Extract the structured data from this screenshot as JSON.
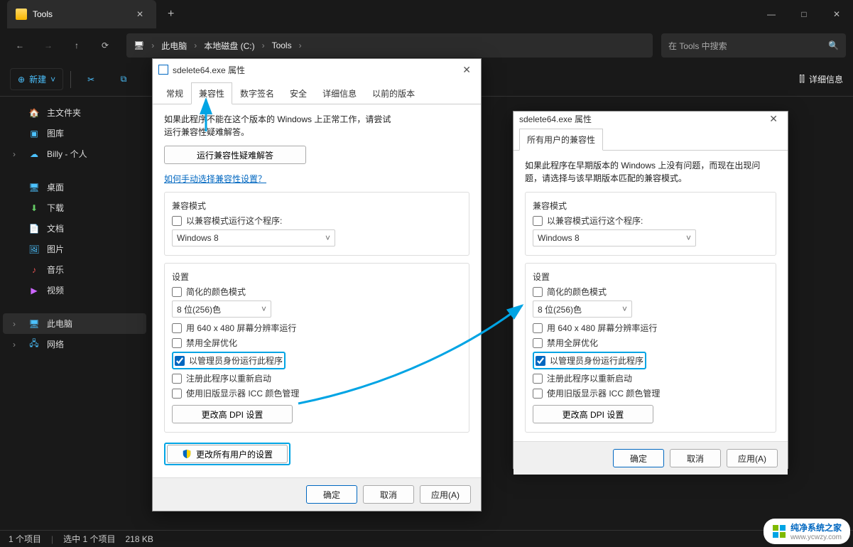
{
  "titlebar": {
    "tab_title": "Tools",
    "newtab": "+"
  },
  "nav": {
    "breadcrumbs": [
      "此电脑",
      "本地磁盘 (C:)",
      "Tools"
    ],
    "search_placeholder": "在 Tools 中搜索"
  },
  "toolbar": {
    "new_label": "新建",
    "details_label": "详细信息"
  },
  "sidebar": {
    "home": "主文件夹",
    "gallery": "图库",
    "user": "Billy - 个人",
    "desktop": "桌面",
    "downloads": "下载",
    "documents": "文档",
    "pictures": "图片",
    "music": "音乐",
    "videos": "视频",
    "thispc": "此电脑",
    "network": "网络"
  },
  "statusbar": {
    "items": "1 个项目",
    "selected": "选中 1 个项目",
    "size": "218 KB"
  },
  "dialog1": {
    "title": "sdelete64.exe 属性",
    "tabs": [
      "常规",
      "兼容性",
      "数字签名",
      "安全",
      "详细信息",
      "以前的版本"
    ],
    "active_tab": 1,
    "intro": "如果此程序不能在这个版本的 Windows 上正常工作，请尝试运行兼容性疑难解答。",
    "troubleshoot_btn": "运行兼容性疑难解答",
    "manual_link": "如何手动选择兼容性设置？",
    "compat_mode_label": "兼容模式",
    "compat_checkbox": "以兼容模式运行这个程序:",
    "compat_os": "Windows 8",
    "settings_label": "设置",
    "reduced_color": "简化的颜色模式",
    "color_depth": "8 位(256)色",
    "res_640": "用 640 x 480 屏幕分辨率运行",
    "disable_fullscreen": "禁用全屏优化",
    "run_admin": "以管理员身份运行此程序",
    "register_restart": "注册此程序以重新启动",
    "legacy_icc": "使用旧版显示器 ICC 颜色管理",
    "change_dpi": "更改高 DPI 设置",
    "all_users_btn": "更改所有用户的设置",
    "ok": "确定",
    "cancel": "取消",
    "apply": "应用(A)"
  },
  "dialog2": {
    "title": "sdelete64.exe 属性",
    "tab": "所有用户的兼容性",
    "intro": "如果此程序在早期版本的 Windows 上没有问题，而现在出现问题，请选择与该早期版本匹配的兼容模式。",
    "compat_mode_label": "兼容模式",
    "compat_checkbox": "以兼容模式运行这个程序:",
    "compat_os": "Windows 8",
    "settings_label": "设置",
    "reduced_color": "简化的颜色模式",
    "color_depth": "8 位(256)色",
    "res_640": "用 640 x 480 屏幕分辨率运行",
    "disable_fullscreen": "禁用全屏优化",
    "run_admin": "以管理员身份运行此程序",
    "register_restart": "注册此程序以重新启动",
    "legacy_icc": "使用旧版显示器 ICC 颜色管理",
    "change_dpi": "更改高 DPI 设置",
    "ok": "确定",
    "cancel": "取消",
    "apply": "应用(A)"
  },
  "watermark": {
    "brand": "纯净系统之家",
    "url": "www.ycwzy.com"
  },
  "icons": {
    "minimize": "—",
    "maximize": "□",
    "close": "✕",
    "back": "←",
    "forward": "→",
    "up": "↑",
    "refresh": "⟳",
    "monitor": "🖥",
    "chevron": "›",
    "search": "🔍",
    "plus_circle": "⊕",
    "scissors": "✂",
    "copy": "⧉",
    "info_panel": "⫿⫿",
    "dropdown": "˅"
  }
}
